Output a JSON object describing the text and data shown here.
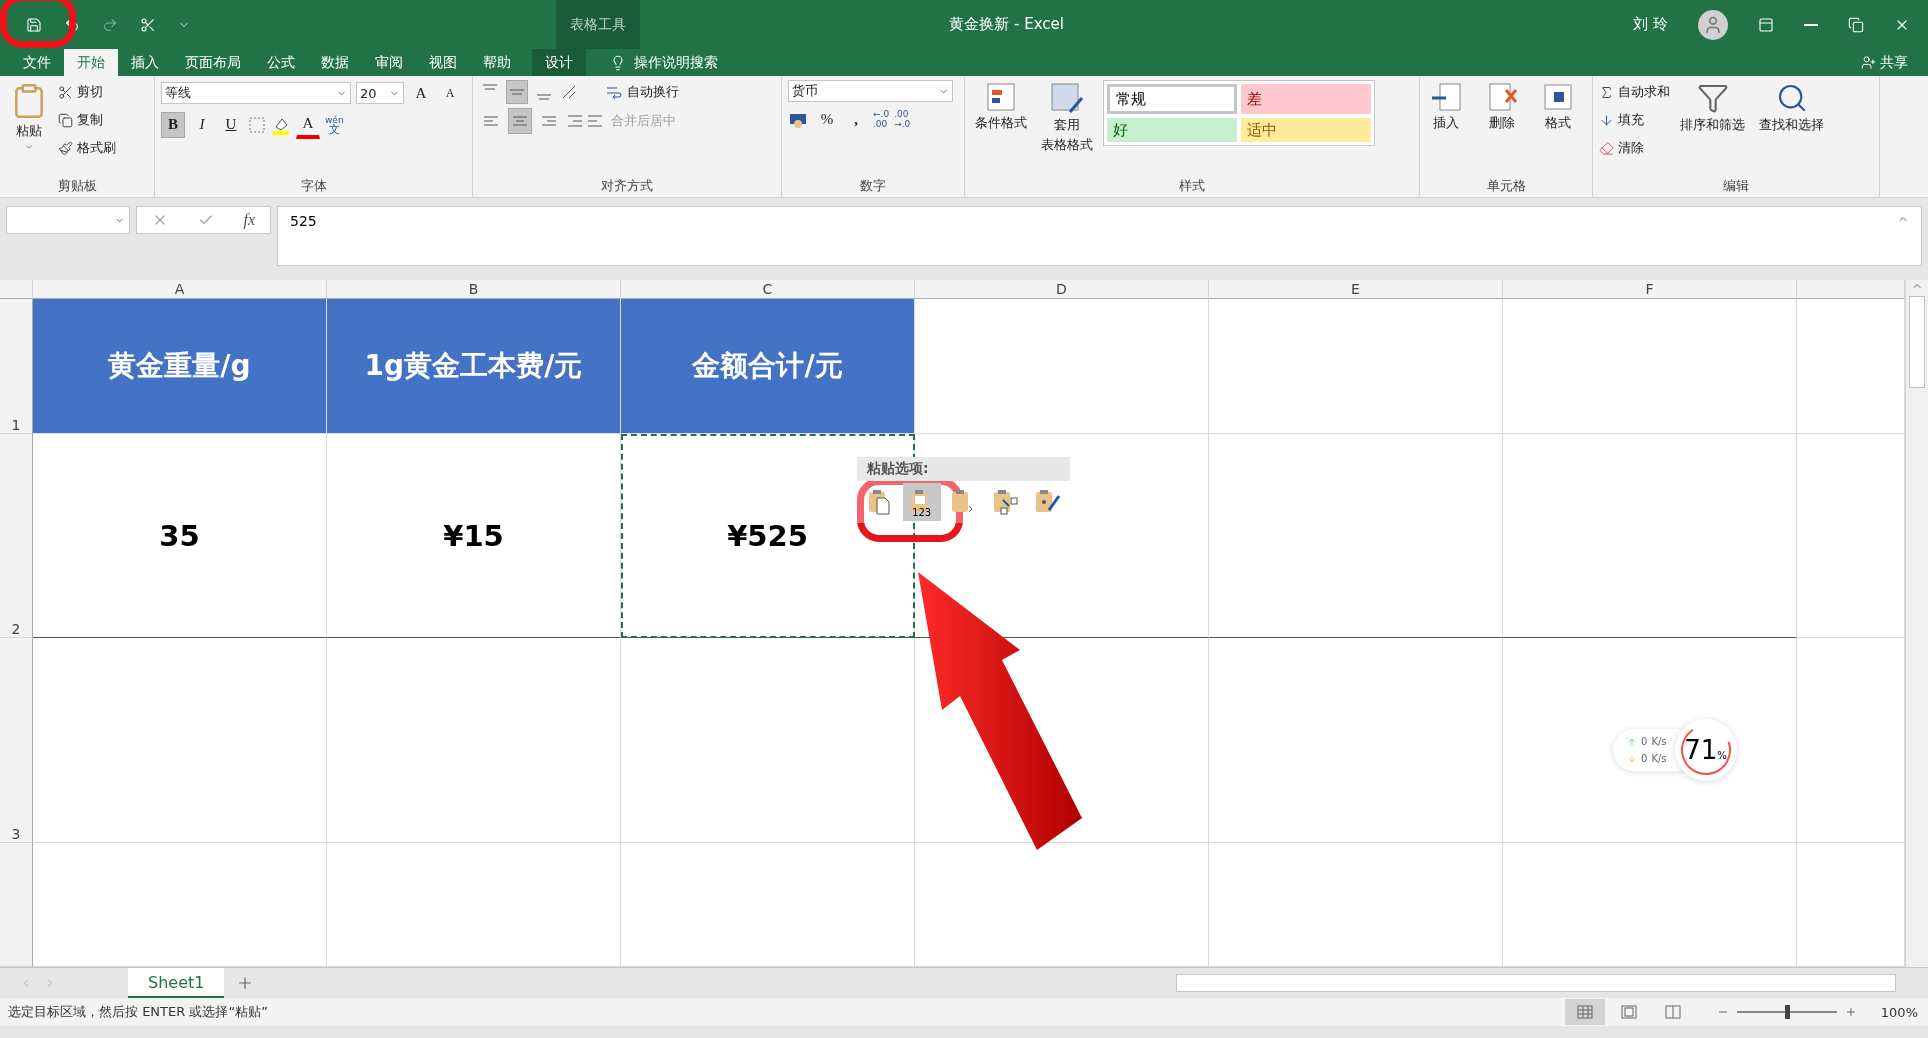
{
  "window": {
    "title": "黄金换新  -  Excel",
    "context_label": "表格工具",
    "user": "刘 玲"
  },
  "tabs": [
    {
      "label": "文件",
      "selected": false,
      "kind": "file"
    },
    {
      "label": "开始",
      "selected": true,
      "kind": "normal"
    },
    {
      "label": "插入",
      "selected": false,
      "kind": "normal"
    },
    {
      "label": "页面布局",
      "selected": false,
      "kind": "normal"
    },
    {
      "label": "公式",
      "selected": false,
      "kind": "normal"
    },
    {
      "label": "数据",
      "selected": false,
      "kind": "normal"
    },
    {
      "label": "审阅",
      "selected": false,
      "kind": "normal"
    },
    {
      "label": "视图",
      "selected": false,
      "kind": "normal"
    },
    {
      "label": "帮助",
      "selected": false,
      "kind": "normal"
    },
    {
      "label": "设计",
      "selected": false,
      "kind": "context"
    }
  ],
  "tell_me": "操作说明搜索",
  "share": "共享",
  "ribbon": {
    "clipboard": {
      "title": "剪贴板",
      "paste": "粘贴",
      "cut": "剪切",
      "copy": "复制",
      "format_painter": "格式刷"
    },
    "font": {
      "title": "字体",
      "font_name": "等线",
      "font_size": "20",
      "grow": "A",
      "shrink": "A",
      "styles": [
        {
          "label": "B",
          "pressed": true
        },
        {
          "label": "I",
          "pressed": false
        },
        {
          "label": "U",
          "pressed": false
        }
      ],
      "font_color": "A",
      "phonetic_top": "wén",
      "phonetic_bottom": "文"
    },
    "alignment": {
      "title": "对齐方式",
      "vertical": [
        {
          "selected": false
        },
        {
          "selected": true
        },
        {
          "selected": false
        }
      ],
      "horizontal": [
        {
          "selected": false
        },
        {
          "selected": true
        },
        {
          "selected": false
        }
      ],
      "wrap_text": "自动换行",
      "merge": {
        "label": "合并后居中",
        "disabled": true
      }
    },
    "number": {
      "title": "数字",
      "format": "货币",
      "percent": "%",
      "comma": ",",
      "increase_decimal": [
        "←.0",
        ".00"
      ],
      "decrease_decimal": [
        ".00",
        "→.0"
      ]
    },
    "styles": {
      "title": "样式",
      "conditional": "条件格式",
      "table_top": "套用",
      "table_bottom": "表格格式",
      "gallery": [
        {
          "label": "常规",
          "color": "#ffffff",
          "kind": "normal"
        },
        {
          "label": "差",
          "color": "#ffc7ce",
          "kind": "bad"
        },
        {
          "label": "好",
          "color": "#c6efce",
          "kind": "good"
        },
        {
          "label": "适中",
          "color": "#ffeb9c",
          "kind": "neutral"
        }
      ]
    },
    "cells": {
      "title": "单元格",
      "insert": "插入",
      "delete": "删除",
      "format": "格式"
    },
    "editing": {
      "title": "编辑",
      "autosum": "自动求和",
      "fill": "填充",
      "clear": "清除",
      "sort": "排序和筛选",
      "find": "查找和选择"
    }
  },
  "formula_bar": {
    "fx": "fx",
    "value": "525"
  },
  "columns": [
    "A",
    "B",
    "C",
    "D",
    "E",
    "F"
  ],
  "rows": [
    {
      "number": "1",
      "kind": "header",
      "cells": [
        {
          "text": "黄金重量/g",
          "copied": false
        },
        {
          "text": "1g黄金工本费/元",
          "copied": false
        },
        {
          "text": "金额合计/元",
          "copied": false
        }
      ]
    },
    {
      "number": "2",
      "kind": "value",
      "cells": [
        {
          "text": "35",
          "copied": false
        },
        {
          "text": "¥15",
          "copied": false
        },
        {
          "text": "¥525",
          "copied": true
        }
      ]
    },
    {
      "number": "3",
      "kind": "value",
      "cells": []
    }
  ],
  "paste_options": {
    "title": "粘贴选项:",
    "buttons": [
      {
        "kind": "paste",
        "selected": false
      },
      {
        "kind": "values",
        "selected": true,
        "label": "123"
      },
      {
        "kind": "formulas",
        "selected": false
      },
      {
        "kind": "transpose",
        "selected": false
      },
      {
        "kind": "formatting",
        "selected": false
      }
    ]
  },
  "sheets": [
    {
      "label": "Sheet1",
      "selected": true
    }
  ],
  "status_bar": {
    "message": "选定目标区域，然后按 ENTER 或选择“粘贴”",
    "zoom": "100%",
    "zoom_slider": {
      "level": 0.5
    },
    "views": [
      {
        "kind": "normal",
        "selected": true
      },
      {
        "kind": "layout",
        "selected": false
      },
      {
        "kind": "break",
        "selected": false
      }
    ]
  },
  "net_widget": {
    "upload": "0",
    "upload_unit": "K/s",
    "download": "0",
    "download_unit": "K/s",
    "percent": "71",
    "percent_sign": "%"
  },
  "annotations": {
    "save_ring": true,
    "paste_ring": true,
    "arrow": true
  }
}
